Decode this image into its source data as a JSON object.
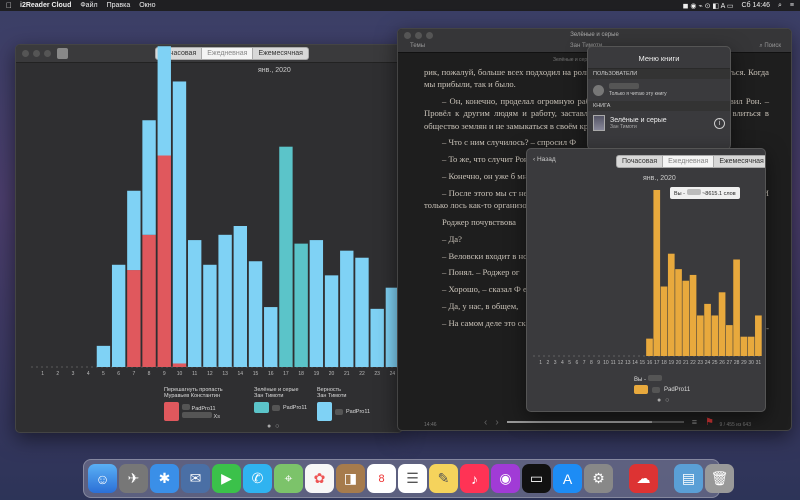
{
  "menubar": {
    "app": "i2Reader Cloud",
    "menus": [
      "Файл",
      "Правка",
      "Окно"
    ],
    "clock": "Сб 14:46"
  },
  "left_window": {
    "tabs": [
      "Почасовая",
      "Ежедневная",
      "Ежемесячная"
    ],
    "selected_tab": "Ежедневная",
    "month": "янв., 2020",
    "legend": [
      {
        "title": "Перешагнуть пропасть",
        "author": "Муравьев Константин",
        "device": "PadPro11",
        "size": "Xs",
        "color": "#e0585d"
      },
      {
        "title": "Зелёные и серые",
        "author": "Зан Тимоти",
        "device": "PadPro11",
        "color": "#5bc4c9"
      },
      {
        "title": "Верность",
        "author": "Зан Тимоти",
        "device": "PadPro11",
        "color": "#7fd2f5"
      }
    ]
  },
  "reader": {
    "title": "Зелёные и серые",
    "toolbar_left": "Темы",
    "toolbar_center": "Зан Тимоти",
    "toolbar_search": "Поиск",
    "subtitle": "Зелёные и серые",
    "paragraphs": [
      "рик, пожалуй, больше всех подходил на роль лидера, с ним было бы легче свыкнуться. Когда мы прибыли, так и было.",
      "– Он, конечно, проделал огромную работу, привыкая к новому миру, – добавил Рон. – Провёл к другим людям и работу, заставлял как можно быстрее устроиться и влиться в общество землян и не замыкаться в своём кругу.",
      "– Что с ним случилось? – спросил Ф",
      "– То же, что случит Рон. – Он умер – умер че",
      "– Конечно, он уже б многие удивлялись, что с",
      "– После этого мы ст не обращался ни к каким явно вел себя ненормал насу и Лорел. – И только лось как-то организоват власть.",
      "Роджер почувствова",
      "– Да?",
      "– Веловски входит в но ни с ним, ни в кустах.",
      "– Понял. – Роджер ог",
      "– Хорошо, – сказал Ф ете в виду аморфную мас",
      "– Да, у нас, в общем,",
      "– На самом деле это сказала Лорел. – Мы м"
    ],
    "tail": "Не зна-",
    "footer_left": "14:46",
    "footer_right": "9 / 455 из 643"
  },
  "book_menu": {
    "title": "Меню книги",
    "users_header": "ПОЛЬЗОВАТЕЛИ",
    "user_note": "Только я читаю эту книгу",
    "book_header": "КНИГА",
    "book_title": "Зелёные и серые",
    "book_author": "Зан Тимоти",
    "info_glyph": "i"
  },
  "daily_popover": {
    "back_label": "Назад",
    "tabs": [
      "Почасовая",
      "Ежедневная",
      "Ежемесячная"
    ],
    "selected_tab": "Ежедневная",
    "month": "янв., 2020",
    "tooltip_prefix": "Вы -",
    "tooltip_value": "~8615.1 слов",
    "legend_label": "Вы -",
    "legend_device": "PadPro11",
    "legend_color": "#e8a93d"
  },
  "chart_data": [
    {
      "type": "bar",
      "title": "янв., 2020",
      "categories": [
        "1",
        "2",
        "3",
        "4",
        "5",
        "6",
        "7",
        "8",
        "9",
        "10",
        "11",
        "12",
        "13",
        "14",
        "15",
        "16",
        "17",
        "18",
        "19",
        "20",
        "21",
        "22",
        "23",
        "24"
      ],
      "series": [
        {
          "name": "Перешагнуть пропасть",
          "values": [
            0,
            0,
            0,
            0,
            0,
            0,
            55,
            75,
            120,
            2,
            0,
            0,
            0,
            0,
            0,
            0,
            0,
            0,
            0,
            0,
            0,
            0,
            0,
            0
          ],
          "color": "#e0585d"
        },
        {
          "name": "Зелёные и серые",
          "values": [
            0,
            0,
            0,
            0,
            0,
            0,
            0,
            0,
            0,
            0,
            0,
            0,
            0,
            0,
            0,
            0,
            125,
            70,
            0,
            0,
            0,
            0,
            0,
            0
          ],
          "color": "#5bc4c9"
        },
        {
          "name": "Верность",
          "values": [
            0,
            0,
            0,
            0,
            12,
            58,
            45,
            65,
            62,
            160,
            72,
            58,
            75,
            80,
            60,
            34,
            0,
            0,
            72,
            52,
            66,
            62,
            33,
            45
          ],
          "color": "#7fd2f5"
        }
      ]
    },
    {
      "type": "bar",
      "title": "янв., 2020",
      "categories": [
        "1",
        "2",
        "3",
        "4",
        "5",
        "6",
        "7",
        "8",
        "9",
        "10",
        "11",
        "12",
        "13",
        "14",
        "15",
        "16",
        "17",
        "18",
        "19",
        "20",
        "21",
        "22",
        "23",
        "24",
        "25",
        "26",
        "27",
        "28",
        "29",
        "30",
        "31"
      ],
      "series": [
        {
          "name": "Вы",
          "values": [
            0,
            0,
            0,
            0,
            0,
            0,
            0,
            0,
            0,
            0,
            0,
            0,
            0,
            0,
            0,
            0.9,
            8.6,
            3.6,
            5.3,
            4.5,
            3.9,
            4.2,
            2.1,
            2.7,
            2.1,
            3.3,
            1.6,
            5.0,
            1.0,
            1.0,
            2.1
          ],
          "color": "#e8a93d"
        }
      ]
    }
  ]
}
